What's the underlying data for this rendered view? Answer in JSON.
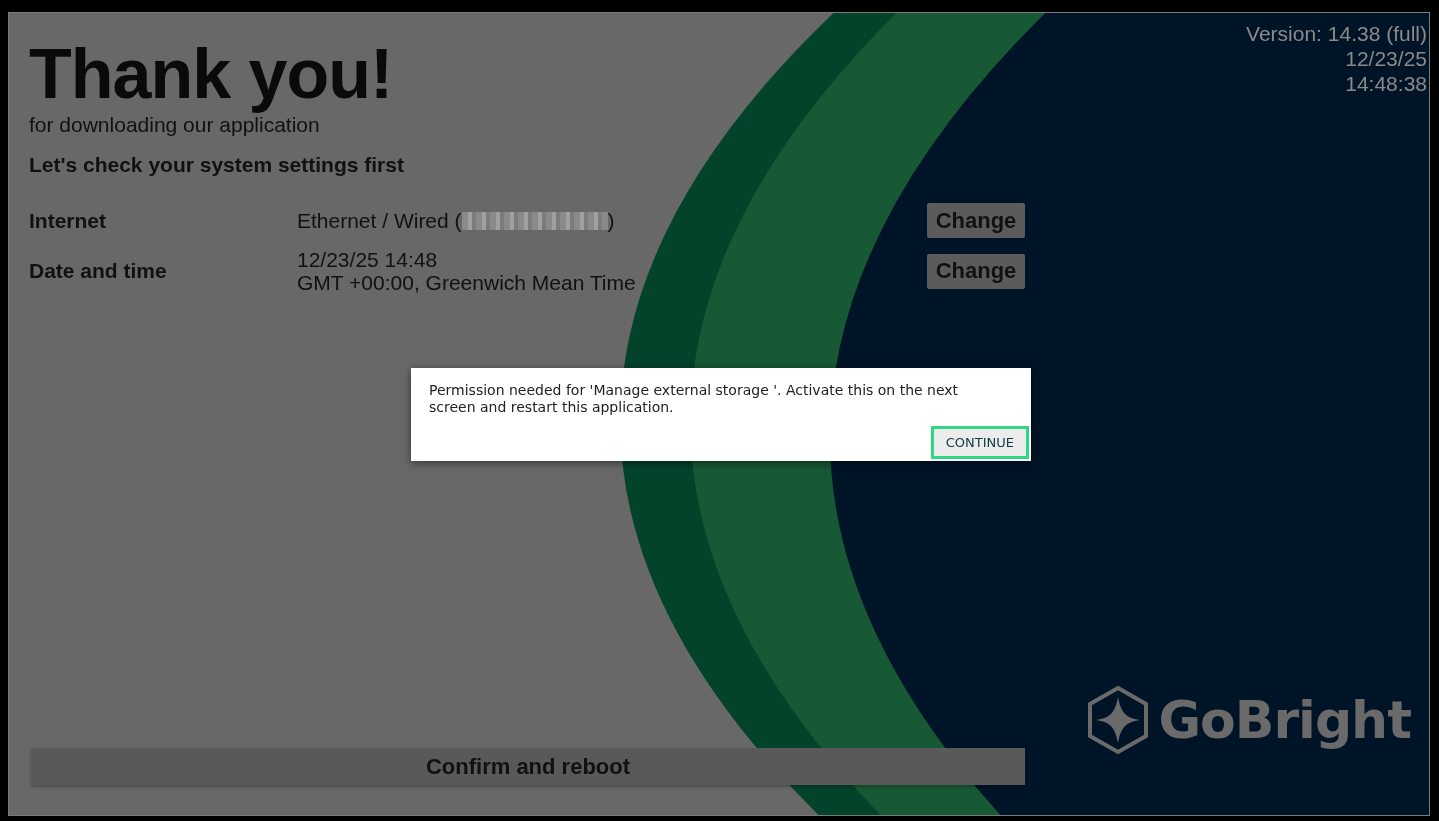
{
  "header": {
    "title": "Thank you!",
    "subtitle": "for downloading our application",
    "section_heading": "Let's check your system settings first"
  },
  "settings": [
    {
      "label": "Internet",
      "kind": "redacted",
      "value_before": "Ethernet / Wired (",
      "value_after": ")",
      "button": "Change"
    },
    {
      "label": "Date and time",
      "kind": "lines",
      "lines": [
        "12/23/25 14:48",
        "GMT +00:00, Greenwich Mean Time"
      ],
      "button": "Change"
    }
  ],
  "confirm_button": "Confirm and reboot",
  "info": [
    "Version: 14.38 (full)",
    "12/23/25",
    "14:48:38"
  ],
  "logo": {
    "text": "GoBright"
  },
  "dialog": {
    "message": "Permission needed for 'Manage external storage '. Activate this on the next screen and restart this application.",
    "button": {
      "label": "CONTINUE",
      "focused": true
    }
  }
}
